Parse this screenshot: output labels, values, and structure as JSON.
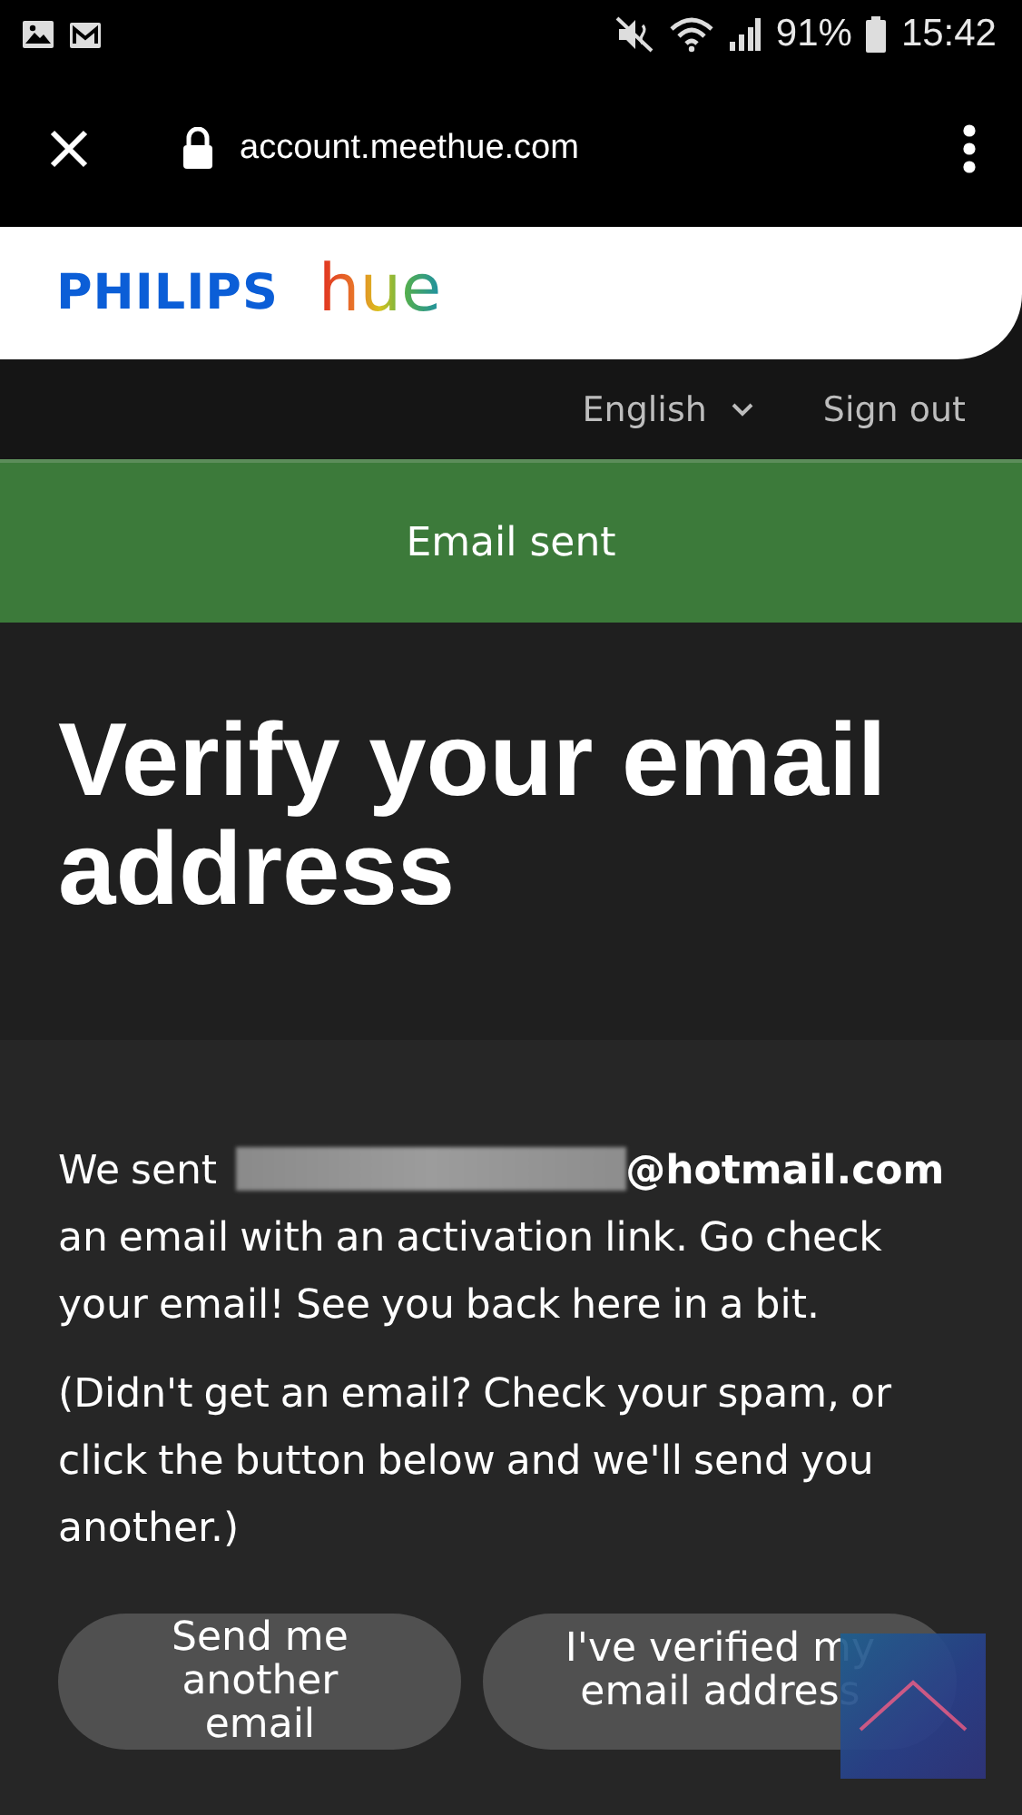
{
  "status_bar": {
    "battery": "91%",
    "time": "15:42"
  },
  "browser_bar": {
    "url": "account.meethue.com"
  },
  "header": {
    "brand": "PHILIPS",
    "product": "hue"
  },
  "nav": {
    "language": "English",
    "sign_out": "Sign out"
  },
  "banner": {
    "text": "Email sent"
  },
  "title": "Verify your email address",
  "body": {
    "sent_prefix": "We sent",
    "email_domain": "@hotmail.com",
    "sent_rest": "an email with an activation link. Go check your email! See you back here in a bit.",
    "hint": "(Didn't get an email? Check your spam, or click the button below and we'll send you another.)"
  },
  "buttons": [
    {
      "label": "Send me another email"
    },
    {
      "label": "I've verified my email address"
    }
  ]
}
